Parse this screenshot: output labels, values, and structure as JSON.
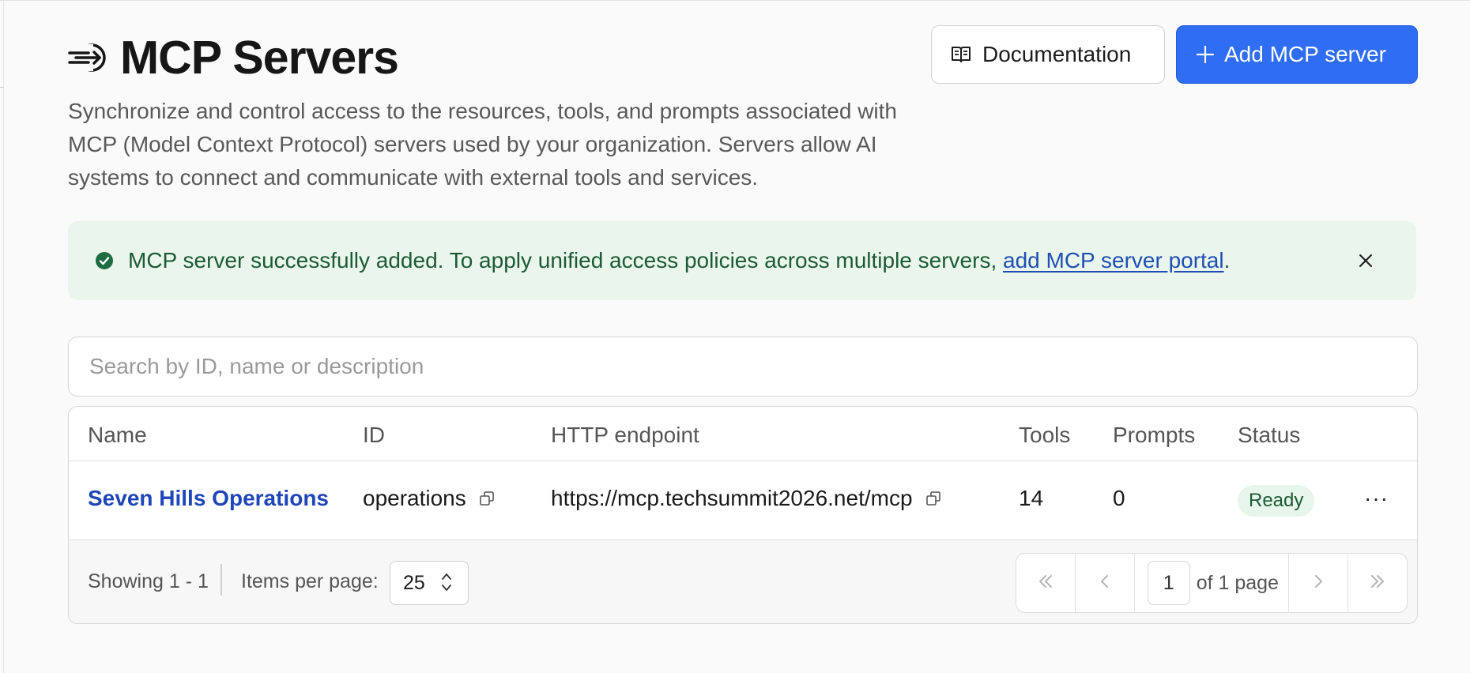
{
  "header": {
    "title": "MCP Servers",
    "icon": "mcp-plug-icon",
    "documentation_label": "Documentation",
    "add_label": "Add MCP server"
  },
  "description": "Synchronize and control access to the resources, tools, and prompts associated with MCP (Model Context Protocol) servers used by your organization. Servers allow AI systems to connect and communicate with external tools and services.",
  "alert": {
    "text": "MCP server successfully added. To apply unified access policies across multiple servers, ",
    "link_text": "add MCP server portal",
    "suffix": ".",
    "status_color": "#1c5a36",
    "background_color": "#eaf6ec"
  },
  "search": {
    "placeholder": "Search by ID, name or description",
    "value": ""
  },
  "table": {
    "columns": [
      "Name",
      "ID",
      "HTTP endpoint",
      "Tools",
      "Prompts",
      "Status"
    ],
    "rows": [
      {
        "name": "Seven Hills Operations",
        "id": "operations",
        "endpoint": "https://mcp.techsummit2026.net/mcp",
        "tools": "14",
        "prompts": "0",
        "status": "Ready"
      }
    ]
  },
  "footer": {
    "showing": "Showing 1 - 1",
    "items_per_page_label": "Items per page:",
    "items_per_page_value": "25",
    "current_page": "1",
    "of_pages": "of 1 page"
  },
  "colors": {
    "accent": "#2f6ef2",
    "link": "#1f46b8",
    "ready_badge_bg": "#e7f5ea"
  }
}
